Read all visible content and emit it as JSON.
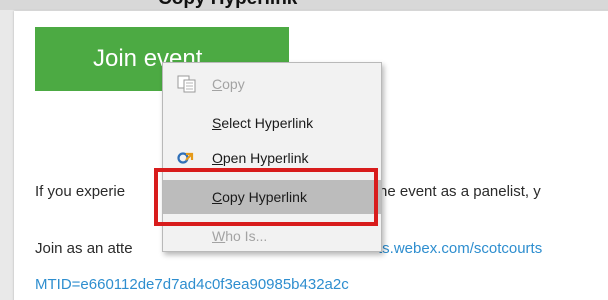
{
  "caption": {
    "text": "Copy Hyperlink"
  },
  "email": {
    "join_button_label": "Join event",
    "line1_before": "If you experie",
    "line1_after": "he event as a panelist, y",
    "line2_before": "Join as an atte",
    "line2_link": "ts.webex.com/scotcourts",
    "line3_link": "MTID=e660112de7d7ad4c0f3ea90985b432a2c"
  },
  "context_menu": {
    "items": [
      {
        "label": "Copy",
        "accel": "C",
        "rest": "opy",
        "enabled": false,
        "icon": "copy-icon"
      },
      {
        "label": "Select Hyperlink",
        "accel": "S",
        "rest": "elect Hyperlink",
        "enabled": true
      },
      {
        "label": "Open Hyperlink",
        "accel": "O",
        "rest": "pen Hyperlink",
        "enabled": true,
        "icon": "open-hyperlink-icon"
      },
      {
        "label": "Copy Hyperlink",
        "accel": "C",
        "rest": "opy Hyperlink",
        "enabled": true,
        "highlighted": true
      },
      {
        "label": "Who Is...",
        "accel": "W",
        "rest": "ho Is...",
        "enabled": false
      }
    ]
  },
  "colors": {
    "join_button_bg": "#4caa43",
    "link_color": "#2e8ecf",
    "highlight_border": "#d81c1c",
    "menu_bg": "#f2f2f2",
    "hover_bg": "#bcbcbc"
  }
}
